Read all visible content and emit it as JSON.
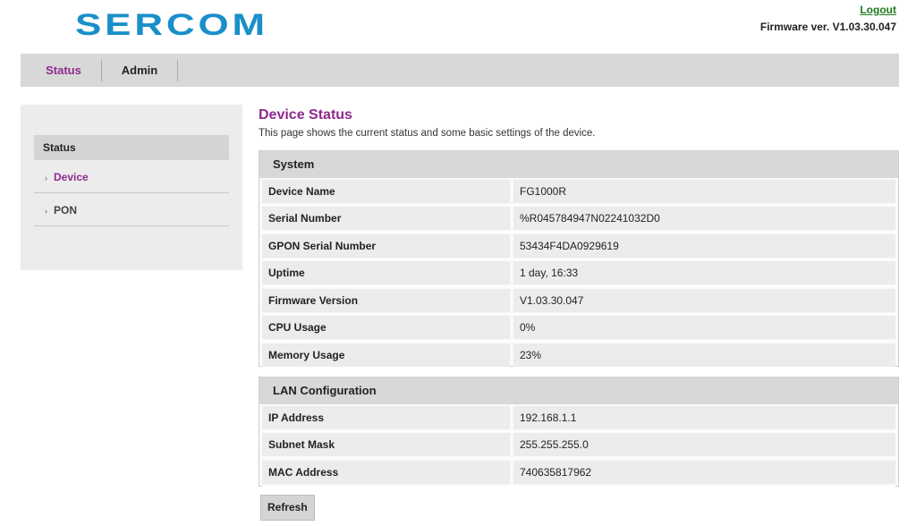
{
  "brand": {
    "logo_text": "SERCOM"
  },
  "header": {
    "logout_label": "Logout",
    "firmware_label": "Firmware ver. V1.03.30.047"
  },
  "nav": {
    "tabs": [
      {
        "label": "Status"
      },
      {
        "label": "Admin"
      }
    ]
  },
  "sidebar": {
    "heading": "Status",
    "items": [
      {
        "label": "Device"
      },
      {
        "label": "PON"
      }
    ]
  },
  "main": {
    "title": "Device Status",
    "description": "This page shows the current status and some basic settings of the device."
  },
  "system": {
    "title": "System",
    "rows": [
      {
        "key": "Device Name",
        "value": "FG1000R"
      },
      {
        "key": "Serial Number",
        "value": "%R045784947N02241032D0"
      },
      {
        "key": "GPON Serial Number",
        "value": "53434F4DA0929619"
      },
      {
        "key": "Uptime",
        "value": "1 day, 16:33"
      },
      {
        "key": "Firmware Version",
        "value": "V1.03.30.047"
      },
      {
        "key": "CPU Usage",
        "value": "0%"
      },
      {
        "key": "Memory Usage",
        "value": "23%"
      }
    ]
  },
  "lan": {
    "title": "LAN Configuration",
    "rows": [
      {
        "key": "IP Address",
        "value": "192.168.1.1"
      },
      {
        "key": "Subnet Mask",
        "value": "255.255.255.0"
      },
      {
        "key": "MAC Address",
        "value": "740635817962"
      }
    ]
  },
  "actions": {
    "refresh_label": "Refresh"
  },
  "colors": {
    "accent": "#8e2a8e",
    "logo": "#1a8fc9",
    "link": "#1e7a1e"
  }
}
